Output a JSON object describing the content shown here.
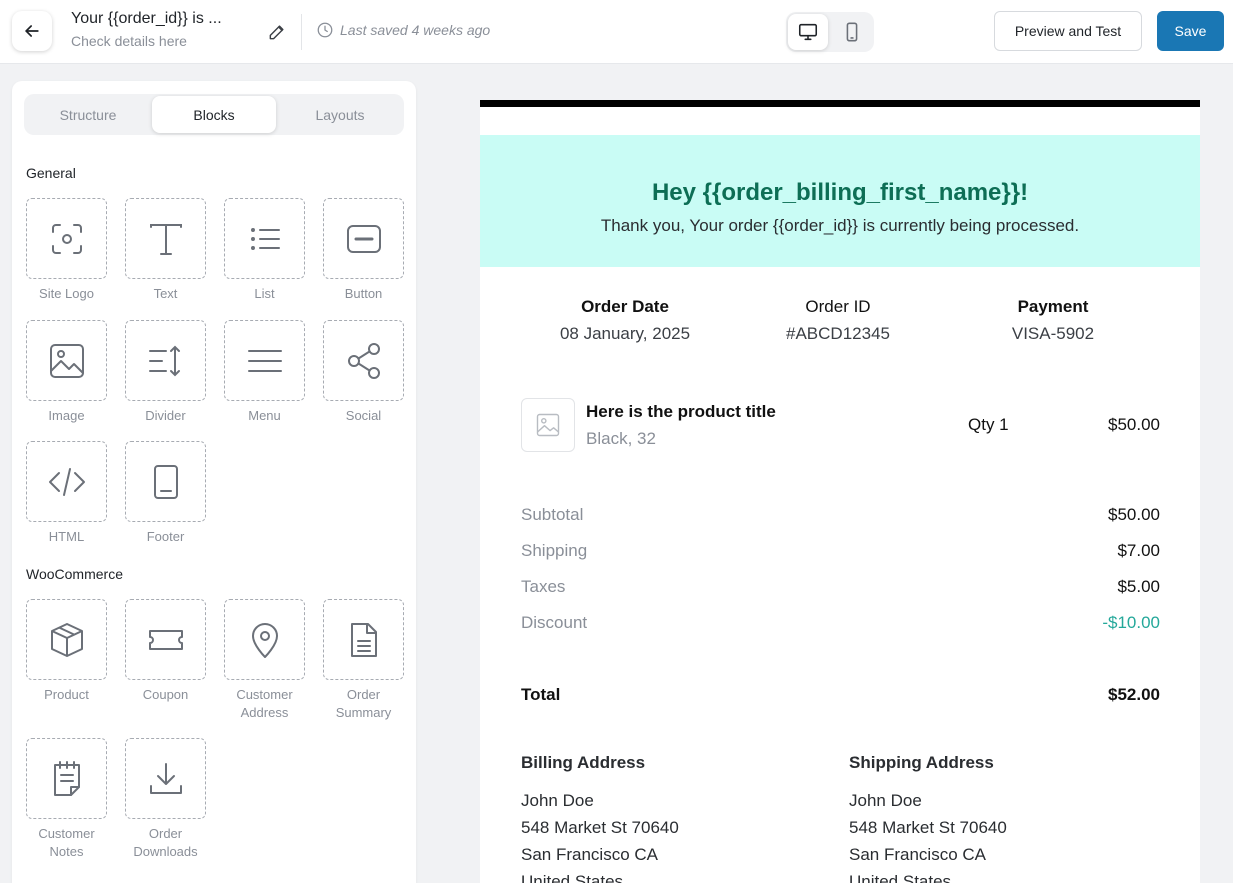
{
  "topbar": {
    "title": "Your {{order_id}} is ...",
    "subtitle": "Check details here",
    "last_saved": "Last saved 4 weeks ago",
    "preview_label": "Preview and Test",
    "save_label": "Save",
    "accent_color": "#1a77b4"
  },
  "sidebar": {
    "tabs": [
      {
        "label": "Structure"
      },
      {
        "label": "Blocks",
        "active": true
      },
      {
        "label": "Layouts"
      }
    ],
    "general_title": "General",
    "general_blocks": [
      {
        "label": "Site Logo",
        "icon": "site-logo-icon"
      },
      {
        "label": "Text",
        "icon": "text-icon"
      },
      {
        "label": "List",
        "icon": "list-icon"
      },
      {
        "label": "Button",
        "icon": "button-icon"
      },
      {
        "label": "Image",
        "icon": "image-icon"
      },
      {
        "label": "Divider",
        "icon": "divider-icon"
      },
      {
        "label": "Menu",
        "icon": "menu-icon"
      },
      {
        "label": "Social",
        "icon": "share-icon"
      },
      {
        "label": "HTML",
        "icon": "code-icon"
      },
      {
        "label": "Footer",
        "icon": "footer-icon"
      }
    ],
    "woo_title": "WooCommerce",
    "woo_blocks": [
      {
        "label": "Product",
        "icon": "box-icon"
      },
      {
        "label": "Coupon",
        "icon": "ticket-icon"
      },
      {
        "label": "Customer Address",
        "icon": "map-pin-icon"
      },
      {
        "label": "Order Summary",
        "icon": "document-icon"
      },
      {
        "label": "Customer Notes",
        "icon": "notes-icon"
      },
      {
        "label": "Order Downloads",
        "icon": "download-icon"
      }
    ]
  },
  "email": {
    "heading": "Hey {{order_billing_first_name}}!",
    "intro": "Thank you, Your order {{order_id}} is currently being processed.",
    "hero_color": "#c9fcf5",
    "meta": [
      {
        "label": "Order Date",
        "value": "08 January, 2025"
      },
      {
        "label": "Order ID",
        "value": "#ABCD12345"
      },
      {
        "label": "Payment",
        "value": "VISA-5902"
      }
    ],
    "product": {
      "title": "Here is the product title",
      "variant": "Black, 32",
      "qty": "Qty 1",
      "price": "$50.00"
    },
    "summary": [
      {
        "label": "Subtotal",
        "value": "$50.00"
      },
      {
        "label": "Shipping",
        "value": "$7.00"
      },
      {
        "label": "Taxes",
        "value": "$5.00"
      },
      {
        "label": "Discount",
        "value": "-$10.00"
      }
    ],
    "total": {
      "label": "Total",
      "value": "$52.00"
    },
    "billing": {
      "title": "Billing Address",
      "name": "John Doe",
      "street": "548 Market St 70640",
      "city": "San Francisco CA",
      "country": "United States"
    },
    "shipping": {
      "title": "Shipping Address",
      "name": "John Doe",
      "street": "548 Market St 70640",
      "city": "San Francisco CA",
      "country": "United States"
    }
  }
}
